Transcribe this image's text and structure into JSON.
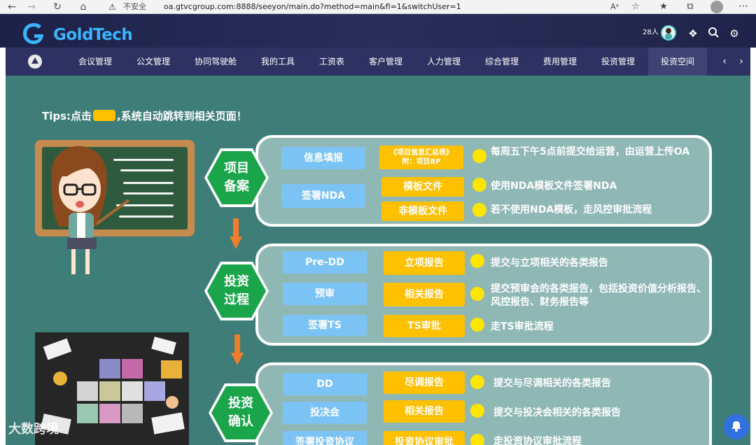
{
  "browser": {
    "warning_label": "不安全",
    "url": "oa.gtvcgroup.com:8888/seeyon/main.do?method=main&fl=1&switchUser=1",
    "reader_label": "Aᵃ"
  },
  "header": {
    "logo_text": "GoldTech",
    "online_count": "28人"
  },
  "nav": {
    "items": [
      "会议管理",
      "公文管理",
      "协同驾驶舱",
      "我的工具",
      "工资表",
      "客户管理",
      "人力管理",
      "综合管理",
      "费用管理",
      "投资管理",
      "投资空间"
    ],
    "active": "投资空间"
  },
  "tips": {
    "prefix": "Tips:点击",
    "suffix": ",系统自动跳转到相关页面！"
  },
  "sections": [
    {
      "title": [
        "项目",
        "备案"
      ],
      "rows": [
        {
          "blue": "信息填报",
          "yellow_main": "《项目信息汇总表》",
          "yellow_sub": "附：项目BP",
          "desc": "每周五下午5点前提交给运营，由运营上传OA"
        },
        {
          "blue": "签署NDA",
          "yellow_main": "模板文件",
          "desc": "使用NDA模板文件签署NDA"
        },
        {
          "yellow_main": "非模板文件",
          "desc": "若不使用NDA模板，走风控审批流程"
        }
      ]
    },
    {
      "title": [
        "投资",
        "过程"
      ],
      "rows": [
        {
          "blue": "Pre-DD",
          "yellow_main": "立项报告",
          "desc": "提交与立项相关的各类报告"
        },
        {
          "blue": "预审",
          "yellow_main": "相关报告",
          "desc": "提交预审会的各类报告，包括投资价值分析报告、风控报告、财务报告等"
        },
        {
          "blue": "签署TS",
          "yellow_main": "TS审批",
          "desc": "走TS审批流程"
        }
      ]
    },
    {
      "title": [
        "投资",
        "确认"
      ],
      "rows": [
        {
          "blue": "DD",
          "yellow_main": "尽调报告",
          "desc": "提交与尽调相关的各类报告"
        },
        {
          "blue": "投决会",
          "yellow_main": "相关报告",
          "desc": "提交与投决会相关的各类报告"
        },
        {
          "blue": "签署投资协议",
          "yellow_main": "投资协议审批",
          "desc": "走投资协议审批流程"
        }
      ]
    }
  ],
  "watermark": "大数跨境",
  "colors": {
    "content_bg": "#3f7d78",
    "box_bg": "#8fb8b4",
    "hex_green": "#1aa54a",
    "button_blue": "#7cc3f5",
    "button_yellow": "#ffc000",
    "arrow_orange": "#f07d2c",
    "nav_bg": "#2d3262"
  }
}
